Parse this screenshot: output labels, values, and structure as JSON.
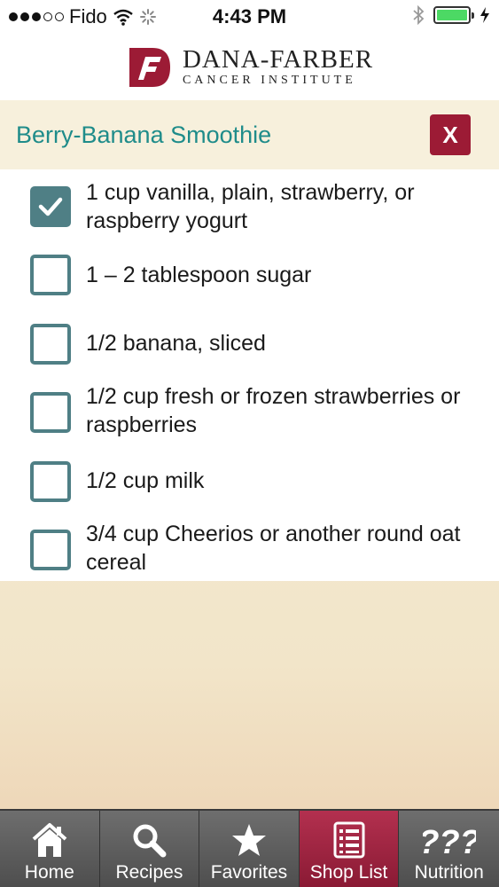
{
  "status_bar": {
    "carrier": "Fido",
    "time": "4:43 PM"
  },
  "logo": {
    "name": "DANA-FARBER",
    "subtitle": "CANCER INSTITUTE"
  },
  "recipe": {
    "title": "Berry-Banana Smoothie",
    "close_label": "X"
  },
  "ingredients": [
    {
      "text": "1 cup vanilla, plain, strawberry, or raspberry yogurt",
      "checked": true
    },
    {
      "text": "1 – 2 tablespoon sugar",
      "checked": false
    },
    {
      "text": "1/2 banana, sliced",
      "checked": false
    },
    {
      "text": "1/2 cup fresh or frozen strawberries or raspberries",
      "checked": false
    },
    {
      "text": "1/2 cup milk",
      "checked": false
    },
    {
      "text": "3/4 cup Cheerios or another round oat cereal",
      "checked": false
    }
  ],
  "tabs": [
    {
      "label": "Home",
      "icon": "home-icon",
      "active": false
    },
    {
      "label": "Recipes",
      "icon": "search-icon",
      "active": false
    },
    {
      "label": "Favorites",
      "icon": "star-icon",
      "active": false
    },
    {
      "label": "Shop List",
      "icon": "list-icon",
      "active": true
    },
    {
      "label": "Nutrition",
      "icon": "question-marks-icon",
      "active": false
    }
  ],
  "colors": {
    "brand": "#9c1b35",
    "title_teal": "#1f8c8a",
    "checkbox": "#4f7f85"
  }
}
